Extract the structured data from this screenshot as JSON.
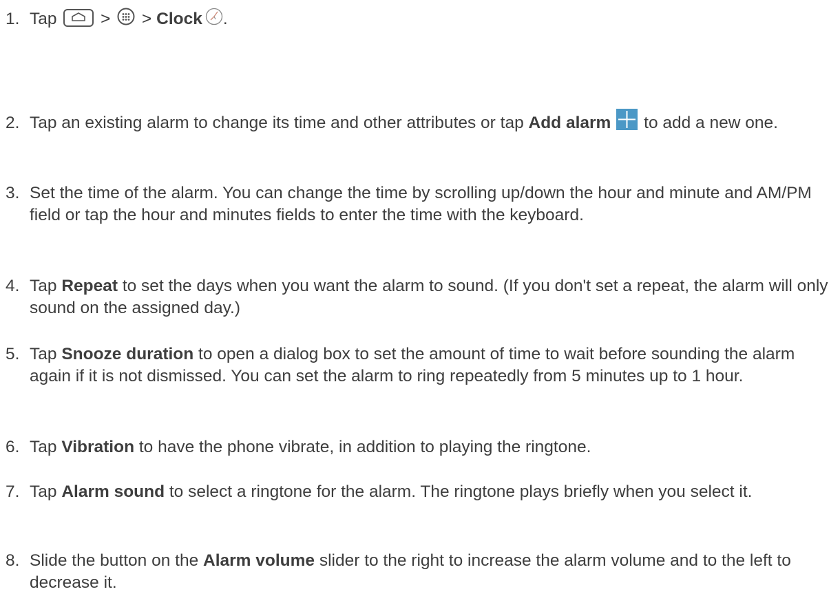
{
  "steps": [
    {
      "num": "1.",
      "parts": {
        "a": "Tap ",
        "b": " > ",
        "c": " > ",
        "bold": "Clock",
        "d": "."
      },
      "icons": [
        "home-icon",
        "apps-icon",
        "clock-icon"
      ]
    },
    {
      "num": "2.",
      "parts": {
        "a": "Tap an existing alarm to change its time and other attributes or tap ",
        "bold": "Add alarm",
        "b": " to add a new one."
      },
      "icons": [
        "add-icon"
      ],
      "colors": {
        "add_icon_fill": "#3b8dbd"
      }
    },
    {
      "num": "3.",
      "text": "Set the time of the alarm. You can change the time by scrolling up/down the hour and minute and AM/PM field or tap the hour and minutes fields to enter the time with the keyboard."
    },
    {
      "num": "4.",
      "parts": {
        "a": "Tap ",
        "bold": "Repeat",
        "b": " to set the days when you want the alarm to sound. (If you don't set a repeat, the alarm will only sound on the assigned day.)"
      }
    },
    {
      "num": "5.",
      "parts": {
        "a": "Tap ",
        "bold": "Snooze duration",
        "b": " to open a dialog box to set the amount of time to wait before sounding the alarm again if it is not dismissed. You can set the alarm to ring repeatedly from 5 minutes up to 1 hour."
      }
    },
    {
      "num": "6.",
      "parts": {
        "a": "Tap ",
        "bold": "Vibration",
        "b": " to have the phone vibrate, in addition to playing the ringtone."
      }
    },
    {
      "num": "7.",
      "parts": {
        "a": "Tap ",
        "bold": "Alarm sound",
        "b": " to select a ringtone for the alarm. The ringtone plays briefly when you select it."
      }
    },
    {
      "num": "8.",
      "parts": {
        "a": "Slide the button on the ",
        "bold": "Alarm volume",
        "b": " slider to the right to increase the alarm volume and to the left to decrease it."
      }
    }
  ],
  "colors": {
    "text": "#3e3e3e",
    "icon_stroke": "#555555",
    "background": "#ffffff"
  }
}
